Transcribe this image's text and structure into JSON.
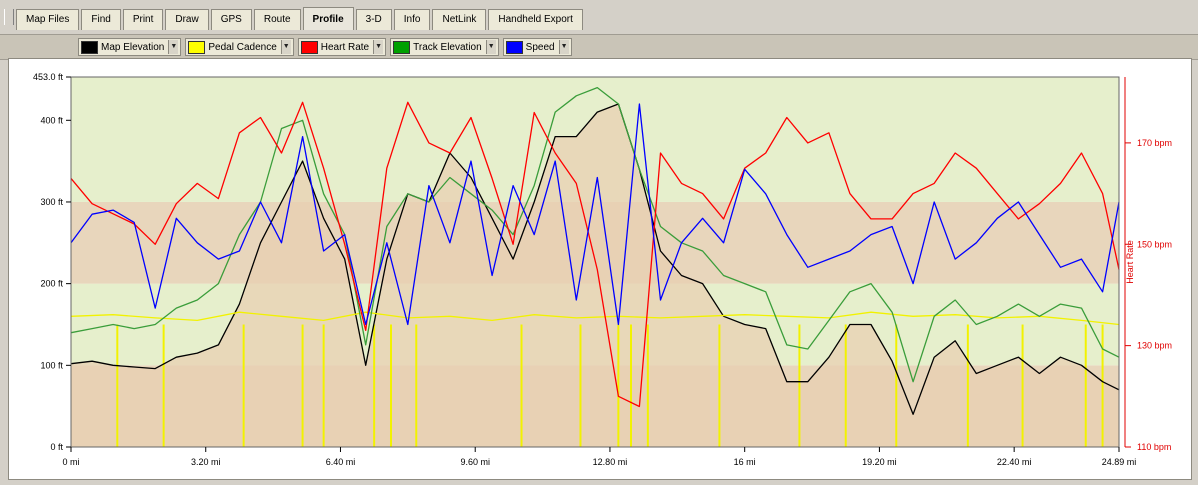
{
  "tabs": [
    {
      "label": "Map Files",
      "active": false
    },
    {
      "label": "Find",
      "active": false
    },
    {
      "label": "Print",
      "active": false
    },
    {
      "label": "Draw",
      "active": false
    },
    {
      "label": "GPS",
      "active": false
    },
    {
      "label": "Route",
      "active": false
    },
    {
      "label": "Profile",
      "active": true
    },
    {
      "label": "3-D",
      "active": false
    },
    {
      "label": "Info",
      "active": false
    },
    {
      "label": "NetLink",
      "active": false
    },
    {
      "label": "Handheld Export",
      "active": false
    }
  ],
  "legend": [
    {
      "label": "Map Elevation",
      "color": "#000000"
    },
    {
      "label": "Pedal Cadence",
      "color": "#ffff00"
    },
    {
      "label": "Heart Rate",
      "color": "#ff0000"
    },
    {
      "label": "Track Elevation",
      "color": "#00a000"
    },
    {
      "label": "Speed",
      "color": "#0000ff"
    }
  ],
  "chart_data": {
    "type": "line",
    "xlim": [
      0,
      24.89
    ],
    "x_unit": "mi",
    "x_ticks": [
      0,
      3.2,
      6.4,
      9.6,
      12.8,
      16,
      19.2,
      22.4,
      24.89
    ],
    "x_tick_labels": [
      "0 mi",
      "3.20 mi",
      "6.40 mi",
      "9.60 mi",
      "12.80 mi",
      "16 mi",
      "19.20 mi",
      "22.40 mi",
      "24.89 mi"
    ],
    "left_axis": {
      "ylim": [
        0,
        453
      ],
      "ticks": [
        0,
        100,
        200,
        300,
        400,
        453
      ],
      "tick_labels": [
        "0 ft",
        "100 ft",
        "200 ft",
        "300 ft",
        "400 ft",
        "453.0 ft"
      ]
    },
    "right_axis": {
      "label": "Heart Rate",
      "color": "#e00000",
      "ylim": [
        110,
        183
      ],
      "ticks": [
        110,
        130,
        150,
        170
      ],
      "tick_labels": [
        "110 bpm",
        "130 bpm",
        "150 bpm",
        "170 bpm"
      ]
    },
    "bands": [
      {
        "y0": 0,
        "y1": 100,
        "color": "#e8d6bc"
      },
      {
        "y0": 100,
        "y1": 200,
        "color": "#e6efcc"
      },
      {
        "y0": 200,
        "y1": 300,
        "color": "#e8d6bc"
      },
      {
        "y0": 300,
        "y1": 453,
        "color": "#e6efcc"
      }
    ],
    "series": [
      {
        "name": "Map Elevation",
        "color": "#000000",
        "axis": "left",
        "fill": "#e8cfb0",
        "x": [
          0,
          0.5,
          1,
          1.5,
          2,
          2.5,
          3,
          3.5,
          4,
          4.5,
          5,
          5.5,
          6,
          6.5,
          7,
          7.5,
          8,
          8.5,
          9,
          9.5,
          10,
          10.5,
          11,
          11.5,
          12,
          12.5,
          13,
          13.5,
          14,
          14.5,
          15,
          15.5,
          16,
          16.5,
          17,
          17.5,
          18,
          18.5,
          19,
          19.5,
          20,
          20.5,
          21,
          21.5,
          22,
          22.5,
          23,
          23.5,
          24,
          24.5,
          24.89
        ],
        "y": [
          102,
          105,
          100,
          98,
          96,
          110,
          115,
          125,
          175,
          250,
          300,
          350,
          280,
          230,
          100,
          230,
          310,
          300,
          360,
          330,
          280,
          230,
          300,
          380,
          380,
          410,
          420,
          340,
          240,
          210,
          200,
          160,
          150,
          145,
          80,
          80,
          110,
          150,
          150,
          105,
          40,
          110,
          130,
          90,
          100,
          110,
          90,
          110,
          100,
          80,
          70
        ]
      },
      {
        "name": "Track Elevation",
        "color": "#3a9d3a",
        "axis": "left",
        "x": [
          0,
          0.5,
          1,
          1.5,
          2,
          2.5,
          3,
          3.5,
          4,
          4.5,
          5,
          5.5,
          6,
          6.5,
          7,
          7.5,
          8,
          8.5,
          9,
          9.5,
          10,
          10.5,
          11,
          11.5,
          12,
          12.5,
          13,
          13.5,
          14,
          14.5,
          15,
          15.5,
          16,
          16.5,
          17,
          17.5,
          18,
          18.5,
          19,
          19.5,
          20,
          20.5,
          21,
          21.5,
          22,
          22.5,
          23,
          23.5,
          24,
          24.5,
          24.89
        ],
        "y": [
          140,
          145,
          150,
          145,
          150,
          170,
          180,
          200,
          260,
          300,
          390,
          400,
          310,
          260,
          125,
          270,
          310,
          300,
          330,
          310,
          290,
          260,
          320,
          410,
          430,
          440,
          420,
          340,
          270,
          250,
          240,
          210,
          200,
          190,
          125,
          120,
          155,
          190,
          200,
          165,
          80,
          160,
          180,
          150,
          160,
          175,
          160,
          175,
          170,
          120,
          110
        ]
      },
      {
        "name": "Heart Rate",
        "color": "#ff0000",
        "axis": "right",
        "x": [
          0,
          0.5,
          1,
          1.5,
          2,
          2.5,
          3,
          3.5,
          4,
          4.5,
          5,
          5.5,
          6,
          6.5,
          7,
          7.5,
          8,
          8.5,
          9,
          9.5,
          10,
          10.5,
          11,
          11.5,
          12,
          12.5,
          13,
          13.5,
          14,
          14.5,
          15,
          15.5,
          16,
          16.5,
          17,
          17.5,
          18,
          18.5,
          19,
          19.5,
          20,
          20.5,
          21,
          21.5,
          22,
          22.5,
          23,
          23.5,
          24,
          24.5,
          24.89
        ],
        "y": [
          163,
          158,
          156,
          154,
          150,
          158,
          162,
          159,
          172,
          175,
          168,
          178,
          165,
          150,
          133,
          165,
          178,
          170,
          168,
          175,
          163,
          150,
          176,
          168,
          162,
          145,
          120,
          118,
          168,
          162,
          160,
          155,
          165,
          168,
          175,
          170,
          172,
          160,
          155,
          155,
          160,
          162,
          168,
          165,
          160,
          155,
          158,
          162,
          168,
          160,
          145
        ]
      },
      {
        "name": "Speed",
        "color": "#0000ff",
        "axis": "left",
        "x": [
          0,
          0.5,
          1,
          1.5,
          2,
          2.5,
          3,
          3.5,
          4,
          4.5,
          5,
          5.5,
          6,
          6.5,
          7,
          7.5,
          8,
          8.5,
          9,
          9.5,
          10,
          10.5,
          11,
          11.5,
          12,
          12.5,
          13,
          13.5,
          14,
          14.5,
          15,
          15.5,
          16,
          16.5,
          17,
          17.5,
          18,
          18.5,
          19,
          19.5,
          20,
          20.5,
          21,
          21.5,
          22,
          22.5,
          23,
          23.5,
          24,
          24.5,
          24.89
        ],
        "y": [
          250,
          285,
          290,
          275,
          170,
          280,
          250,
          230,
          240,
          300,
          250,
          380,
          240,
          260,
          150,
          250,
          150,
          320,
          250,
          350,
          210,
          320,
          260,
          350,
          180,
          330,
          150,
          420,
          180,
          250,
          280,
          250,
          340,
          310,
          260,
          220,
          230,
          240,
          260,
          270,
          200,
          300,
          230,
          250,
          280,
          300,
          260,
          220,
          230,
          190,
          300
        ]
      },
      {
        "name": "Pedal Cadence",
        "color": "#f2f200",
        "axis": "left",
        "x": [
          0,
          1,
          2,
          3,
          4,
          5,
          6,
          7,
          8,
          9,
          10,
          11,
          12,
          13,
          14,
          15,
          16,
          17,
          18,
          19,
          20,
          21,
          22,
          23,
          24,
          24.89
        ],
        "y": [
          160,
          162,
          158,
          155,
          165,
          160,
          155,
          165,
          158,
          160,
          155,
          162,
          158,
          160,
          158,
          160,
          162,
          160,
          158,
          165,
          160,
          162,
          158,
          160,
          155,
          150
        ],
        "dips": [
          1.1,
          2.2,
          4.1,
          5.5,
          6.0,
          7.2,
          7.6,
          8.2,
          10.7,
          12.1,
          13.0,
          13.3,
          13.7,
          15.4,
          17.3,
          18.4,
          19.6,
          21.3,
          22.6,
          24.1,
          24.5
        ]
      }
    ]
  }
}
